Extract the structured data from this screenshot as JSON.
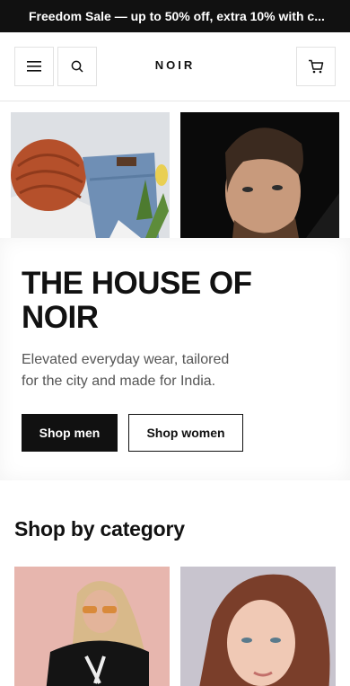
{
  "announcement": {
    "text": "Freedom Sale — up to 50% off, extra 10% with c..."
  },
  "header": {
    "logo": "NOIR",
    "icons": {
      "menu": "menu-icon",
      "search": "search-icon",
      "cart": "cart-icon"
    }
  },
  "hero": {
    "title": "THE HOUSE OF NOIR",
    "subtitle": "Elevated everyday wear, tailored for the city and made for India.",
    "buttons": {
      "men": "Shop men",
      "women": "Shop women"
    }
  },
  "categories": {
    "title": "Shop by category"
  },
  "colors": {
    "dark": "#111111",
    "announce_bg": "#111111",
    "text_muted": "#555555",
    "border": "#e2e2e2"
  }
}
